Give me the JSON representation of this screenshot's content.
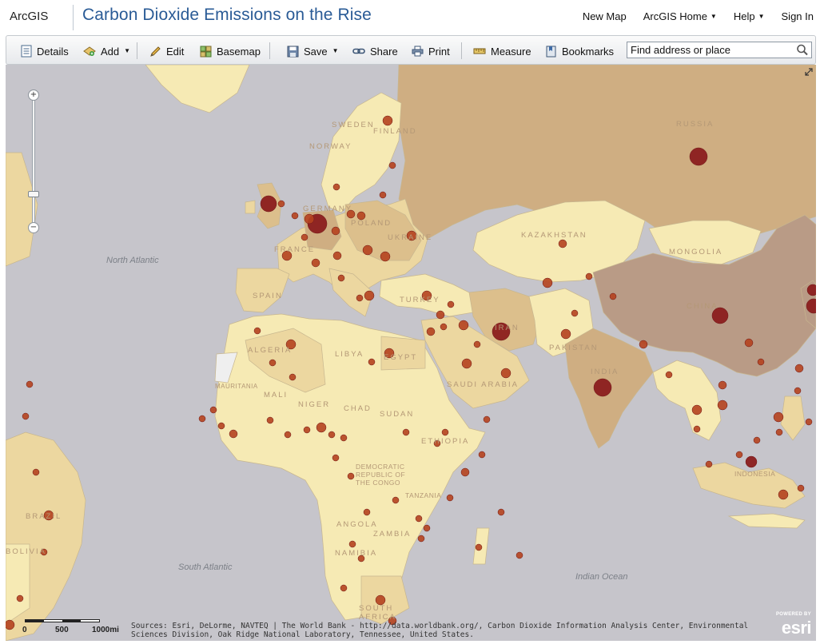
{
  "brand": "ArcGIS",
  "title": "Carbon Dioxide Emissions on the Rise",
  "nav": {
    "new_map": "New Map",
    "arcgis_home": "ArcGIS Home",
    "help": "Help",
    "sign_in": "Sign In"
  },
  "toolbar": {
    "details": "Details",
    "add": "Add",
    "edit": "Edit",
    "basemap": "Basemap",
    "save": "Save",
    "share": "Share",
    "print": "Print",
    "measure": "Measure",
    "bookmarks": "Bookmarks"
  },
  "search": {
    "placeholder": "Find address or place"
  },
  "map": {
    "country_labels": {
      "sweden": "SWEDEN",
      "finland": "FINLAND",
      "norway": "NORWAY",
      "russia": "RUSSIA",
      "germany": "GERMANY",
      "poland": "POLAND",
      "ukraine": "UKRAINE",
      "france": "FRANCE",
      "spain": "SPAIN",
      "turkey": "TURKEY",
      "kazakhstan": "KAZAKHSTAN",
      "mongolia": "MONGOLIA",
      "china": "CHINA",
      "iran": "IRAN",
      "pakistan": "PAKISTAN",
      "india": "INDIA",
      "algeria": "ALGERIA",
      "libya": "LIBYA",
      "egypt": "EGYPT",
      "saudi_arabia": "SAUDI ARABIA",
      "mauritania": "MAURITANIA",
      "mali": "MALI",
      "niger": "NIGER",
      "chad": "CHAD",
      "sudan": "SUDAN",
      "ethiopia": "ETHIOPIA",
      "drc": "DEMOCRATIC REPUBLIC OF THE CONGO",
      "tanzania": "TANZANIA",
      "angola": "ANGOLA",
      "zambia": "ZAMBIA",
      "namibia": "NAMIBIA",
      "south_africa": "SOUTH AFRICA",
      "brazil": "BRAZIL",
      "bolivia": "BOLIVIA",
      "indonesia": "INDONESIA"
    },
    "ocean_labels": {
      "north_atlantic": "North Atlantic",
      "south_atlantic": "South Atlantic",
      "indian_ocean": "Indian Ocean"
    },
    "colors": {
      "ocean": "#c6c5cb",
      "land_low": "#f6eab4",
      "land_mid_low": "#ecd7a0",
      "land_mid": "#dcbf8c",
      "land_high": "#cfae82",
      "land_top": "#b99b86",
      "symbol": "#8b1e1e",
      "symbol_small": "#b5421f"
    },
    "scale": {
      "label_0": "0",
      "label_500": "500",
      "label_1000": "1000mi"
    },
    "attribution": "Sources: Esri, DeLorme, NAVTEQ | The World Bank - http://data.worldbank.org/, Carbon Dioxide Information Analysis Center, Environmental Sciences Division, Oak Ridge National Laboratory, Tennessee, United States.",
    "logo_caption": "POWERED BY",
    "logo_text": "esri"
  }
}
